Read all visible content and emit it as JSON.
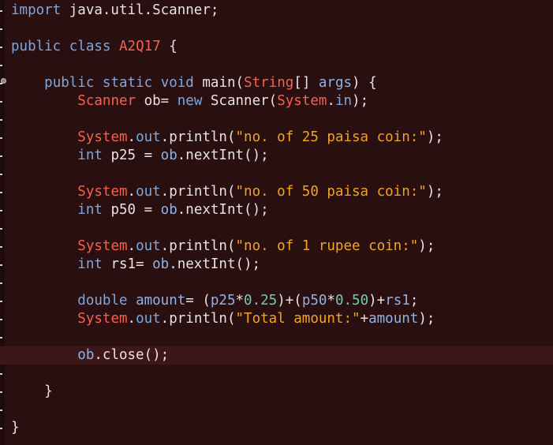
{
  "editor": {
    "lines": [
      [
        {
          "t": "import",
          "c": "kw"
        },
        {
          "t": " java.util.Scanner;",
          "c": "plain"
        }
      ],
      [],
      [
        {
          "t": "public",
          "c": "kw"
        },
        {
          "t": " ",
          "c": "plain"
        },
        {
          "t": "class",
          "c": "kw"
        },
        {
          "t": " ",
          "c": "plain"
        },
        {
          "t": "A2Q17",
          "c": "type"
        },
        {
          "t": " {",
          "c": "plain"
        }
      ],
      [],
      [
        {
          "t": "    ",
          "c": "plain"
        },
        {
          "t": "public",
          "c": "kw"
        },
        {
          "t": " ",
          "c": "plain"
        },
        {
          "t": "static",
          "c": "kw"
        },
        {
          "t": " ",
          "c": "plain"
        },
        {
          "t": "void",
          "c": "kw"
        },
        {
          "t": " main(",
          "c": "plain"
        },
        {
          "t": "String",
          "c": "type"
        },
        {
          "t": "[] ",
          "c": "plain"
        },
        {
          "t": "args",
          "c": "var"
        },
        {
          "t": ") {",
          "c": "plain"
        }
      ],
      [
        {
          "t": "        ",
          "c": "plain"
        },
        {
          "t": "Scanner",
          "c": "type"
        },
        {
          "t": " ob= ",
          "c": "plain"
        },
        {
          "t": "new",
          "c": "kw"
        },
        {
          "t": " Scanner(",
          "c": "plain"
        },
        {
          "t": "System",
          "c": "type"
        },
        {
          "t": ".",
          "c": "plain"
        },
        {
          "t": "in",
          "c": "fld"
        },
        {
          "t": ");",
          "c": "plain"
        }
      ],
      [],
      [
        {
          "t": "        ",
          "c": "plain"
        },
        {
          "t": "System",
          "c": "type"
        },
        {
          "t": ".",
          "c": "plain"
        },
        {
          "t": "out",
          "c": "fld"
        },
        {
          "t": ".println(",
          "c": "plain"
        },
        {
          "t": "\"no. of 25 paisa coin:\"",
          "c": "str"
        },
        {
          "t": ");",
          "c": "plain"
        }
      ],
      [
        {
          "t": "        ",
          "c": "plain"
        },
        {
          "t": "int",
          "c": "kw"
        },
        {
          "t": " p25 = ",
          "c": "plain"
        },
        {
          "t": "ob",
          "c": "var"
        },
        {
          "t": ".nextInt();",
          "c": "plain"
        }
      ],
      [],
      [
        {
          "t": "        ",
          "c": "plain"
        },
        {
          "t": "System",
          "c": "type"
        },
        {
          "t": ".",
          "c": "plain"
        },
        {
          "t": "out",
          "c": "fld"
        },
        {
          "t": ".println(",
          "c": "plain"
        },
        {
          "t": "\"no. of 50 paisa coin:\"",
          "c": "str"
        },
        {
          "t": ");",
          "c": "plain"
        }
      ],
      [
        {
          "t": "        ",
          "c": "plain"
        },
        {
          "t": "int",
          "c": "kw"
        },
        {
          "t": " p50 = ",
          "c": "plain"
        },
        {
          "t": "ob",
          "c": "var"
        },
        {
          "t": ".nextInt();",
          "c": "plain"
        }
      ],
      [],
      [
        {
          "t": "        ",
          "c": "plain"
        },
        {
          "t": "System",
          "c": "type"
        },
        {
          "t": ".",
          "c": "plain"
        },
        {
          "t": "out",
          "c": "fld"
        },
        {
          "t": ".println(",
          "c": "plain"
        },
        {
          "t": "\"no. of 1 rupee coin:\"",
          "c": "str"
        },
        {
          "t": ");",
          "c": "plain"
        }
      ],
      [
        {
          "t": "        ",
          "c": "plain"
        },
        {
          "t": "int",
          "c": "kw"
        },
        {
          "t": " rs1= ",
          "c": "plain"
        },
        {
          "t": "ob",
          "c": "var"
        },
        {
          "t": ".nextInt();",
          "c": "plain"
        }
      ],
      [],
      [
        {
          "t": "        ",
          "c": "plain"
        },
        {
          "t": "double",
          "c": "kw"
        },
        {
          "t": " ",
          "c": "plain"
        },
        {
          "t": "amount",
          "c": "var"
        },
        {
          "t": "= (",
          "c": "plain"
        },
        {
          "t": "p25",
          "c": "var"
        },
        {
          "t": "*",
          "c": "plain"
        },
        {
          "t": "0.25",
          "c": "num"
        },
        {
          "t": ")+(",
          "c": "plain"
        },
        {
          "t": "p50",
          "c": "var"
        },
        {
          "t": "*",
          "c": "plain"
        },
        {
          "t": "0.50",
          "c": "num"
        },
        {
          "t": ")+",
          "c": "plain"
        },
        {
          "t": "rs1",
          "c": "var"
        },
        {
          "t": ";",
          "c": "plain"
        }
      ],
      [
        {
          "t": "        ",
          "c": "plain"
        },
        {
          "t": "System",
          "c": "type"
        },
        {
          "t": ".",
          "c": "plain"
        },
        {
          "t": "out",
          "c": "fld"
        },
        {
          "t": ".println(",
          "c": "plain"
        },
        {
          "t": "\"Total amount:\"",
          "c": "str"
        },
        {
          "t": "+",
          "c": "plain"
        },
        {
          "t": "amount",
          "c": "var"
        },
        {
          "t": ");",
          "c": "plain"
        }
      ],
      [],
      [
        {
          "t": "        ",
          "c": "plain"
        },
        {
          "t": "ob",
          "c": "var"
        },
        {
          "t": ".close();",
          "c": "plain"
        }
      ],
      [],
      [
        {
          "t": "    }",
          "c": "plain"
        }
      ],
      [],
      [
        {
          "t": "}",
          "c": "plain"
        }
      ]
    ],
    "current_line": 19
  },
  "colors": {
    "background": "#2a0f10",
    "keyword": "#7fa7dd",
    "type": "#f2624e",
    "string": "#f0a422",
    "number": "#72c9b4",
    "variable": "#8fb3e6",
    "current_line_highlight": "#3d1619"
  },
  "icons": {
    "fold_marker": "fold-collapse-icon"
  }
}
